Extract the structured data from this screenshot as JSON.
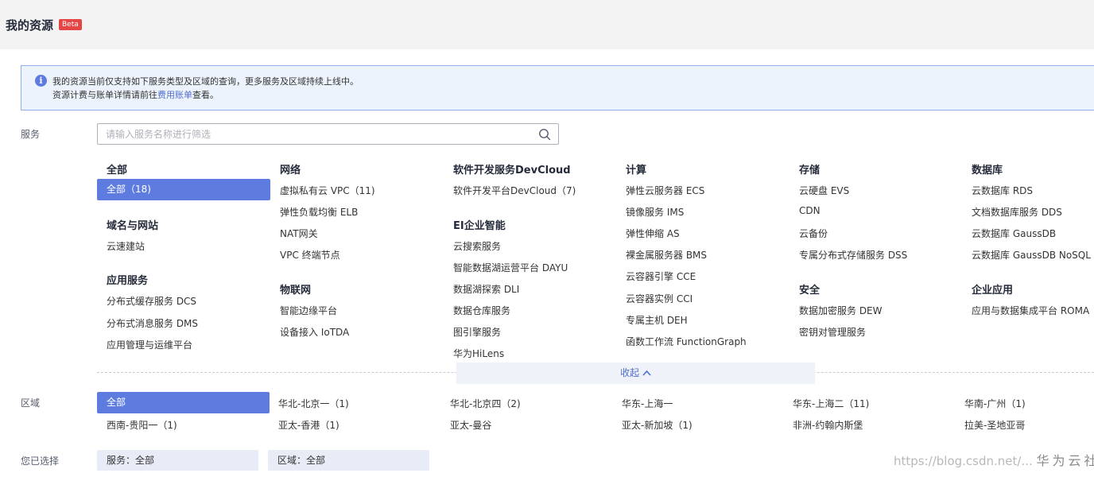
{
  "header": {
    "title": "我的资源",
    "badge": "Beta"
  },
  "notice": {
    "line1": "我的资源当前仅支持如下服务类型及区域的查询，更多服务及区域持续上线中。",
    "line2_prefix": "资源计费与账单详情请前往",
    "line2_link": "费用账单",
    "line2_suffix": "查看。"
  },
  "service": {
    "label": "服务",
    "search_placeholder": "请输入服务名称进行筛选",
    "search_value": "",
    "categories": [
      {
        "title": "全部",
        "items": [
          "全部（18)"
        ]
      },
      {
        "title": "域名与网站",
        "items": [
          "云速建站"
        ]
      },
      {
        "title": "应用服务",
        "items": [
          "分布式缓存服务 DCS",
          "分布式消息服务 DMS",
          "应用管理与运维平台"
        ]
      },
      {
        "title": "网络",
        "items": [
          "虚拟私有云 VPC（11)",
          "弹性负载均衡 ELB",
          "NAT网关",
          "VPC 终端节点"
        ]
      },
      {
        "title": "物联网",
        "items": [
          "智能边缘平台",
          "设备接入 IoTDA"
        ]
      },
      {
        "title": "软件开发服务DevCloud",
        "items": [
          "软件开发平台DevCloud（7)"
        ]
      },
      {
        "title": "EI企业智能",
        "items": [
          "云搜索服务",
          "智能数据湖运营平台 DAYU",
          "数据湖探索 DLI",
          "数据仓库服务",
          "图引擎服务",
          "华为HiLens"
        ]
      },
      {
        "title": "计算",
        "items": [
          "弹性云服务器 ECS",
          "镜像服务 IMS",
          "弹性伸缩 AS",
          "裸金属服务器 BMS",
          "云容器引擎 CCE",
          "云容器实例 CCI",
          "专属主机 DEH",
          "函数工作流 FunctionGraph"
        ]
      },
      {
        "title": "存储",
        "items": [
          "云硬盘 EVS",
          "CDN",
          "云备份",
          "专属分布式存储服务 DSS"
        ]
      },
      {
        "title": "安全",
        "items": [
          "数据加密服务 DEW",
          "密钥对管理服务"
        ]
      },
      {
        "title": "数据库",
        "items": [
          "云数据库 RDS",
          "文档数据库服务 DDS",
          "云数据库 GaussDB",
          "云数据库 GaussDB NoSQL"
        ]
      },
      {
        "title": "企业应用",
        "items": [
          "应用与数据集成平台 ROMA"
        ]
      }
    ],
    "collapse_label": "收起"
  },
  "region": {
    "label": "区域",
    "items": [
      "全部",
      "华北-北京一（1)",
      "华北-北京四（2)",
      "华东-上海一",
      "华东-上海二（11)",
      "华南-广州（1)",
      "西南-贵阳一（1)",
      "亚太-香港（1)",
      "亚太-曼谷",
      "亚太-新加坡（1)",
      "非洲-约翰内斯堡",
      "拉美-圣地亚哥"
    ]
  },
  "selected": {
    "label": "您已选择",
    "service_chip": "服务：全部",
    "region_chip": "区域：全部"
  },
  "watermark": {
    "url": "https://blog.csdn.net/...",
    "logo": "华为云社区"
  },
  "colors": {
    "primary": "#5e7ce0",
    "link": "#526ecc",
    "notice_bg": "#edf3fc",
    "badge": "#e54545"
  }
}
